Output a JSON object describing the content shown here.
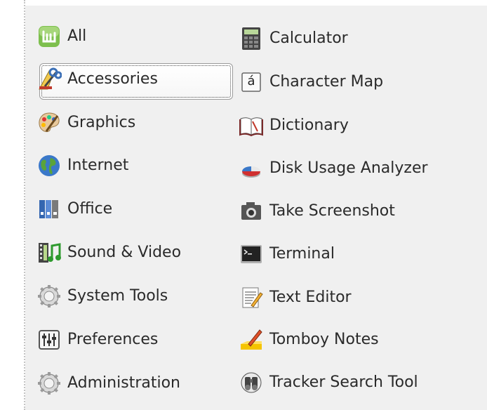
{
  "categories": [
    {
      "label": "All",
      "icon": "mint-logo-icon"
    },
    {
      "label": "Accessories",
      "icon": "accessories-icon",
      "selected": true
    },
    {
      "label": "Graphics",
      "icon": "palette-icon"
    },
    {
      "label": "Internet",
      "icon": "globe-icon"
    },
    {
      "label": "Office",
      "icon": "binders-icon"
    },
    {
      "label": "Sound & Video",
      "icon": "film-music-icon"
    },
    {
      "label": "System Tools",
      "icon": "gear-icon"
    },
    {
      "label": "Preferences",
      "icon": "sliders-icon"
    },
    {
      "label": "Administration",
      "icon": "gear-icon"
    }
  ],
  "apps": [
    {
      "label": "Calculator",
      "icon": "calculator-icon"
    },
    {
      "label": "Character Map",
      "icon": "character-map-icon",
      "glyph": "á"
    },
    {
      "label": "Dictionary",
      "icon": "book-icon"
    },
    {
      "label": "Disk Usage Analyzer",
      "icon": "pie-disk-icon"
    },
    {
      "label": "Take Screenshot",
      "icon": "camera-icon"
    },
    {
      "label": "Terminal",
      "icon": "terminal-icon"
    },
    {
      "label": "Text Editor",
      "icon": "text-editor-icon"
    },
    {
      "label": "Tomboy Notes",
      "icon": "note-pencil-icon"
    },
    {
      "label": "Tracker Search Tool",
      "icon": "binoculars-icon"
    }
  ]
}
